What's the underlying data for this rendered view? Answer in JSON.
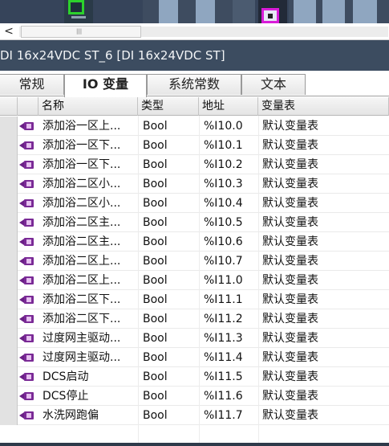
{
  "device_strip": {
    "selected_module": "DI 16x24VDC ST_6"
  },
  "scrollbar": {
    "left_arrow": "<",
    "grip": "|||"
  },
  "window": {
    "title": "DI 16x24VDC ST_6 [DI 16x24VDC ST]"
  },
  "tabs": [
    {
      "label": "常规",
      "active": false
    },
    {
      "label": "IO 变量",
      "active": true
    },
    {
      "label": "系统常数",
      "active": false
    },
    {
      "label": "文本",
      "active": false
    }
  ],
  "table": {
    "headers": {
      "name": "名称",
      "type": "类型",
      "address": "地址",
      "tag_table": "变量表"
    },
    "rows": [
      {
        "name": "添加浴一区上...",
        "type": "Bool",
        "address": "%I10.0",
        "tag_table": "默认变量表"
      },
      {
        "name": "添加浴一区下...",
        "type": "Bool",
        "address": "%I10.1",
        "tag_table": "默认变量表"
      },
      {
        "name": "添加浴一区下...",
        "type": "Bool",
        "address": "%I10.2",
        "tag_table": "默认变量表"
      },
      {
        "name": "添加浴二区小...",
        "type": "Bool",
        "address": "%I10.3",
        "tag_table": "默认变量表"
      },
      {
        "name": "添加浴二区小...",
        "type": "Bool",
        "address": "%I10.4",
        "tag_table": "默认变量表"
      },
      {
        "name": "添加浴二区主...",
        "type": "Bool",
        "address": "%I10.5",
        "tag_table": "默认变量表"
      },
      {
        "name": "添加浴二区主...",
        "type": "Bool",
        "address": "%I10.6",
        "tag_table": "默认变量表"
      },
      {
        "name": "添加浴二区上...",
        "type": "Bool",
        "address": "%I10.7",
        "tag_table": "默认变量表"
      },
      {
        "name": "添加浴二区上...",
        "type": "Bool",
        "address": "%I11.0",
        "tag_table": "默认变量表"
      },
      {
        "name": "添加浴二区下...",
        "type": "Bool",
        "address": "%I11.1",
        "tag_table": "默认变量表"
      },
      {
        "name": "添加浴二区下...",
        "type": "Bool",
        "address": "%I11.2",
        "tag_table": "默认变量表"
      },
      {
        "name": "过度网主驱动...",
        "type": "Bool",
        "address": "%I11.3",
        "tag_table": "默认变量表"
      },
      {
        "name": "过度网主驱动...",
        "type": "Bool",
        "address": "%I11.4",
        "tag_table": "默认变量表"
      },
      {
        "name": "DCS启动",
        "type": "Bool",
        "address": "%I11.5",
        "tag_table": "默认变量表"
      },
      {
        "name": "DCS停止",
        "type": "Bool",
        "address": "%I11.6",
        "tag_table": "默认变量表"
      },
      {
        "name": "水洗网跑偏",
        "type": "Bool",
        "address": "%I11.7",
        "tag_table": "默认变量表"
      }
    ]
  },
  "colors": {
    "title_bar": "#3c4c60",
    "tag_icon": "#7a2a96",
    "selected_module_border": "#d81cd8",
    "status_module_border": "#2cd12c"
  }
}
